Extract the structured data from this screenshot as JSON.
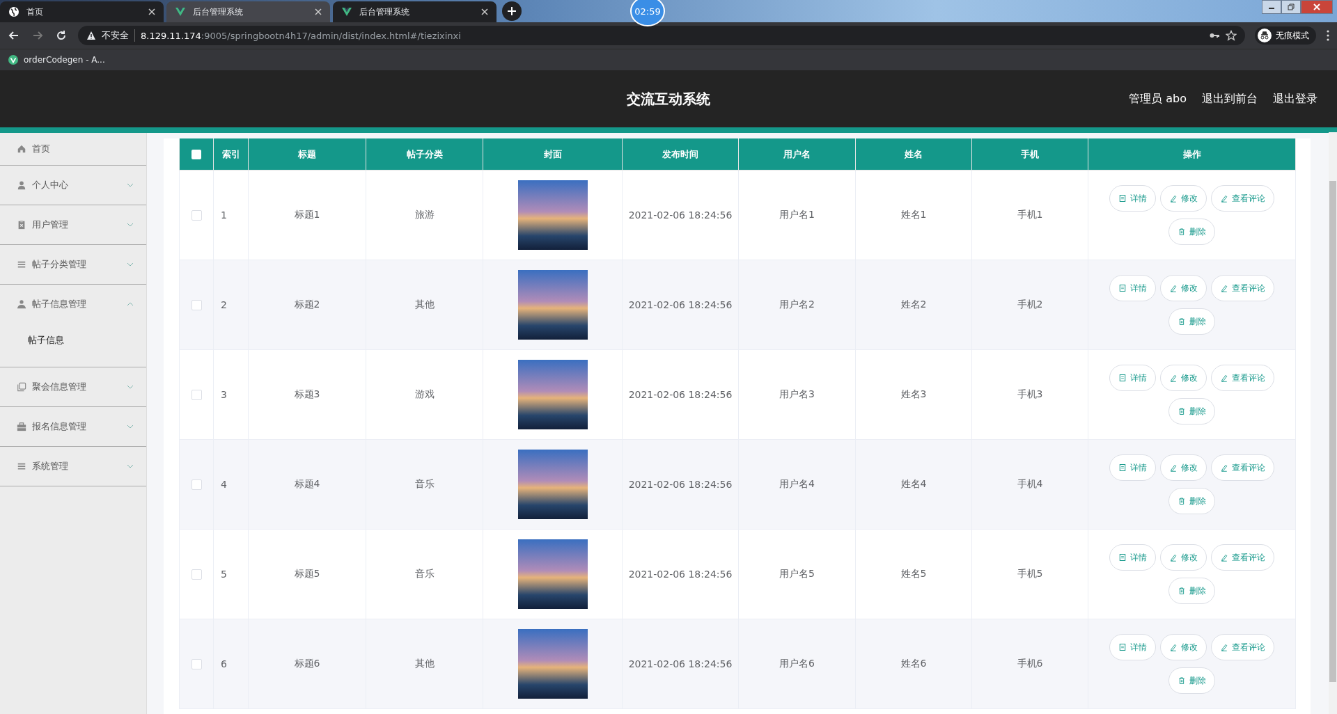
{
  "browser": {
    "tabs": [
      {
        "title": "首页",
        "selected": false
      },
      {
        "title": "后台管理系统",
        "selected": true
      },
      {
        "title": "后台管理系统",
        "selected": false
      }
    ],
    "recorder_timer": "02:59",
    "address": {
      "security": "不安全",
      "host": "8.129.11.174",
      "path": ":9005/springbootn4h17/admin/dist/index.html#/tiezixinxi"
    },
    "profile": "无痕模式",
    "bookmarks": [
      {
        "title": "orderCodegen - A..."
      }
    ]
  },
  "header": {
    "title": "交流互动系统",
    "links": [
      "管理员 abo",
      "退出到前台",
      "退出登录"
    ]
  },
  "sidebar": {
    "items": [
      {
        "label": "首页"
      },
      {
        "label": "个人中心",
        "expanded": false
      },
      {
        "label": "用户管理",
        "expanded": false
      },
      {
        "label": "帖子分类管理",
        "expanded": false
      },
      {
        "label": "帖子信息管理",
        "expanded": true,
        "children": [
          {
            "label": "帖子信息"
          }
        ]
      },
      {
        "label": "聚会信息管理",
        "expanded": false
      },
      {
        "label": "报名信息管理",
        "expanded": false
      },
      {
        "label": "系统管理",
        "expanded": false
      }
    ]
  },
  "table": {
    "header_checkbox": {
      "checked": false
    },
    "columns": [
      "索引",
      "标题",
      "帖子分类",
      "封面",
      "发布时间",
      "用户名",
      "姓名",
      "手机",
      "操作"
    ],
    "rows": [
      {
        "checked": false,
        "index": "1",
        "title": "标题1",
        "category": "旅游",
        "time": "2021-02-06 18:24:56",
        "username": "用户名1",
        "name": "姓名1",
        "phone": "手机1",
        "actions": [
          "详情",
          "修改",
          "查看评论",
          "删除"
        ]
      },
      {
        "checked": false,
        "index": "2",
        "title": "标题2",
        "category": "其他",
        "time": "2021-02-06 18:24:56",
        "username": "用户名2",
        "name": "姓名2",
        "phone": "手机2",
        "actions": [
          "详情",
          "修改",
          "查看评论",
          "删除"
        ]
      },
      {
        "checked": false,
        "index": "3",
        "title": "标题3",
        "category": "游戏",
        "time": "2021-02-06 18:24:56",
        "username": "用户名3",
        "name": "姓名3",
        "phone": "手机3",
        "actions": [
          "详情",
          "修改",
          "查看评论",
          "删除"
        ]
      },
      {
        "checked": false,
        "index": "4",
        "title": "标题4",
        "category": "音乐",
        "time": "2021-02-06 18:24:56",
        "username": "用户名4",
        "name": "姓名4",
        "phone": "手机4",
        "actions": [
          "详情",
          "修改",
          "查看评论",
          "删除"
        ]
      },
      {
        "checked": false,
        "index": "5",
        "title": "标题5",
        "category": "音乐",
        "time": "2021-02-06 18:24:56",
        "username": "用户名5",
        "name": "姓名5",
        "phone": "手机5",
        "actions": [
          "详情",
          "修改",
          "查看评论",
          "删除"
        ]
      },
      {
        "checked": false,
        "index": "6",
        "title": "标题6",
        "category": "其他",
        "time": "2021-02-06 18:24:56",
        "username": "用户名6",
        "name": "姓名6",
        "phone": "手机6",
        "actions": [
          "详情",
          "修改",
          "查看评论",
          "删除"
        ]
      }
    ]
  }
}
